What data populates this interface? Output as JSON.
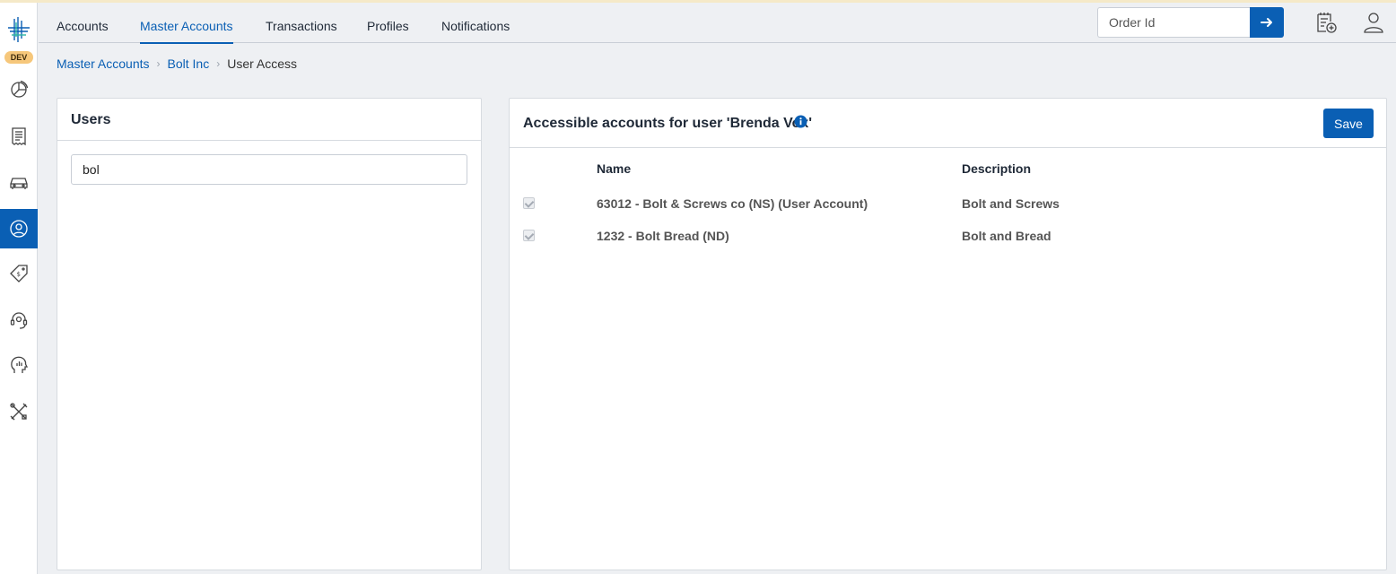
{
  "env_badge": "DEV",
  "nav": {
    "tabs": [
      {
        "label": "Accounts",
        "active": false
      },
      {
        "label": "Master Accounts",
        "active": true
      },
      {
        "label": "Transactions",
        "active": false
      },
      {
        "label": "Profiles",
        "active": false
      },
      {
        "label": "Notifications",
        "active": false
      }
    ],
    "order_placeholder": "Order Id"
  },
  "sidebar": {
    "items": [
      {
        "icon": "pie-chart-icon",
        "active": false
      },
      {
        "icon": "receipt-icon",
        "active": false
      },
      {
        "icon": "car-icon",
        "active": false
      },
      {
        "icon": "user-circle-icon",
        "active": true
      },
      {
        "icon": "price-tag-icon",
        "active": false
      },
      {
        "icon": "headset-icon",
        "active": false
      },
      {
        "icon": "head-analytics-icon",
        "active": false
      },
      {
        "icon": "tools-icon",
        "active": false
      }
    ]
  },
  "breadcrumb": {
    "items": [
      "Master Accounts",
      "Bolt Inc"
    ],
    "current": "User Access"
  },
  "users_panel": {
    "title": "Users",
    "search_value": "bol"
  },
  "access_panel": {
    "title": "Accessible accounts for user 'Brenda Vox'",
    "save_label": "Save",
    "columns": {
      "name": "Name",
      "description": "Description"
    },
    "rows": [
      {
        "name": "63012 - Bolt & Screws co (NS) (User Account)",
        "description": "Bolt and Screws",
        "checked": true
      },
      {
        "name": "1232 - Bolt Bread (ND)",
        "description": "Bolt and Bread",
        "checked": true
      }
    ]
  },
  "colors": {
    "accent": "#0a5fb4",
    "dev_badge": "#f6c77b",
    "background": "#eef0f3"
  }
}
